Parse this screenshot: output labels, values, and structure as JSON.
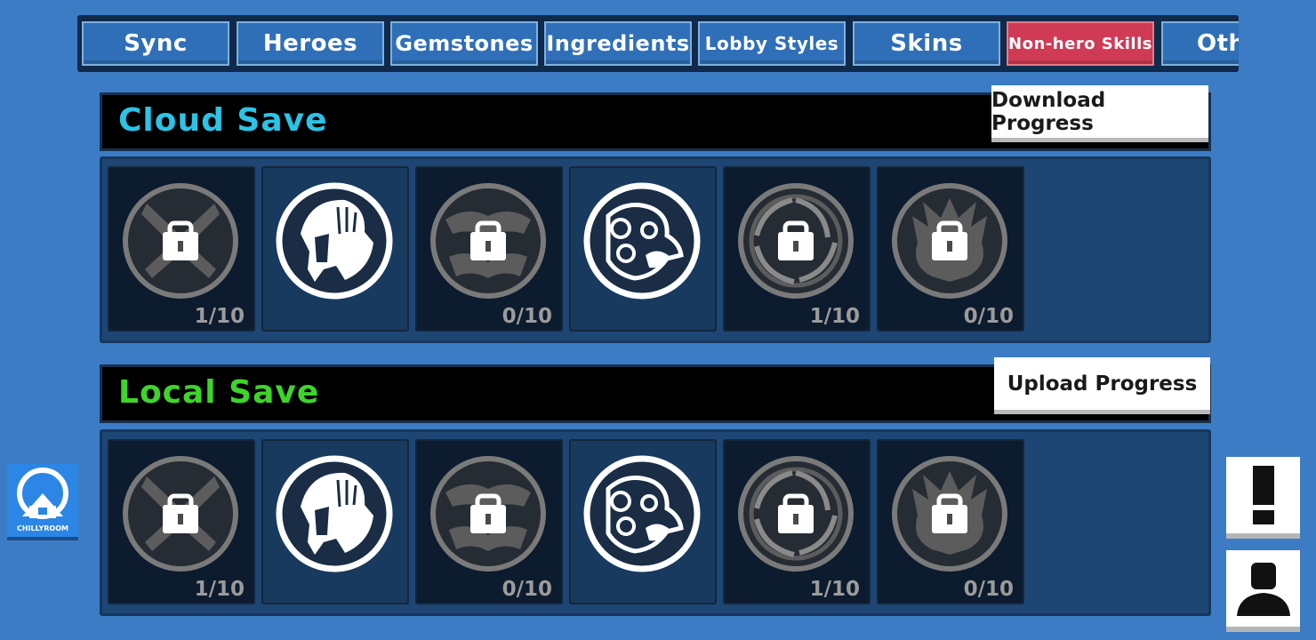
{
  "tabs": [
    {
      "label": "Sync",
      "active": false
    },
    {
      "label": "Heroes",
      "active": false
    },
    {
      "label": "Gemstones",
      "active": false
    },
    {
      "label": "Ingredients",
      "active": false
    },
    {
      "label": "Lobby Styles",
      "active": false
    },
    {
      "label": "Skins",
      "active": false
    },
    {
      "label": "Non-hero Skills",
      "active": true
    },
    {
      "label": "Oth",
      "active": false
    }
  ],
  "cloud": {
    "title": "Cloud Save",
    "title_color": "#2bc3e6",
    "button": "Download Progress",
    "items": [
      {
        "icon": "crossed-blades-icon",
        "locked": true,
        "count": "1/10"
      },
      {
        "icon": "spartan-helmet-icon",
        "locked": false,
        "count": ""
      },
      {
        "icon": "demon-face-icon",
        "locked": true,
        "count": "0/10"
      },
      {
        "icon": "octopus-icon",
        "locked": false,
        "count": ""
      },
      {
        "icon": "vortex-icon",
        "locked": true,
        "count": "1/10"
      },
      {
        "icon": "beast-face-icon",
        "locked": true,
        "count": "0/10"
      }
    ]
  },
  "local": {
    "title": "Local Save",
    "title_color": "#3fd42a",
    "button": "Upload Progress",
    "items": [
      {
        "icon": "crossed-blades-icon",
        "locked": true,
        "count": "1/10"
      },
      {
        "icon": "spartan-helmet-icon",
        "locked": false,
        "count": ""
      },
      {
        "icon": "demon-face-icon",
        "locked": true,
        "count": "0/10"
      },
      {
        "icon": "octopus-icon",
        "locked": false,
        "count": ""
      },
      {
        "icon": "vortex-icon",
        "locked": true,
        "count": "1/10"
      },
      {
        "icon": "beast-face-icon",
        "locked": true,
        "count": "0/10"
      }
    ]
  },
  "logo": {
    "text": "CHILLYROOM",
    "icon": "chillyroom-logo-icon"
  },
  "side": {
    "alert_icon": "exclamation-icon",
    "account_icon": "user-icon"
  }
}
